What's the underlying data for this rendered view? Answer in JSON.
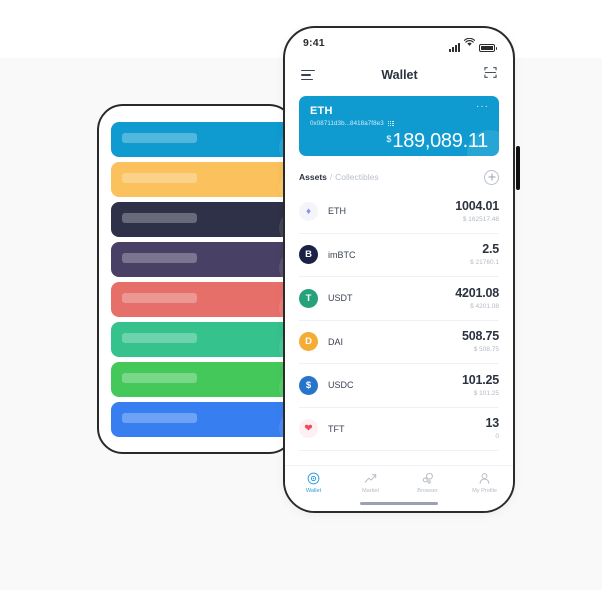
{
  "device": {
    "status_bar": {
      "time": "9:41",
      "icons": [
        "signal-icon",
        "wifi-icon",
        "battery-icon"
      ]
    }
  },
  "header": {
    "menu_icon": "hamburger-menu-icon",
    "title": "Wallet",
    "scan_icon": "scan-qr-icon"
  },
  "balance_card": {
    "wallet_name": "ETH",
    "address": "0x08711d3b...8418a7f8e3",
    "copy_icon": "copy-address-icon",
    "more_icon": "more-options-icon",
    "currency_symbol": "$",
    "amount": "189,089.11",
    "color": "#0f9bd0"
  },
  "tabs": {
    "assets_label": "Assets",
    "separator": "/",
    "collectibles_label": "Collectibles",
    "add_icon": "add-asset-icon"
  },
  "assets": [
    {
      "symbol": "ETH",
      "amount": "1004.01",
      "fiat": "$ 162517.48",
      "icon": "eth-icon",
      "icon_bg": "#f4f5f8",
      "icon_color": "#8a90f0",
      "glyph": "♦"
    },
    {
      "symbol": "imBTC",
      "amount": "2.5",
      "fiat": "$ 21760.1",
      "icon": "imbtc-icon",
      "icon_bg": "#1c2145",
      "icon_color": "#ffffff",
      "glyph": "B"
    },
    {
      "symbol": "USDT",
      "amount": "4201.08",
      "fiat": "$ 4201.08",
      "icon": "usdt-icon",
      "icon_bg": "#26a17b",
      "icon_color": "#ffffff",
      "glyph": "T"
    },
    {
      "symbol": "DAI",
      "amount": "508.75",
      "fiat": "$ 508.75",
      "icon": "dai-icon",
      "icon_bg": "#f5ac37",
      "icon_color": "#ffffff",
      "glyph": "D"
    },
    {
      "symbol": "USDC",
      "amount": "101.25",
      "fiat": "$ 101.25",
      "icon": "usdc-icon",
      "icon_bg": "#2775ca",
      "icon_color": "#ffffff",
      "glyph": "$"
    },
    {
      "symbol": "TFT",
      "amount": "13",
      "fiat": "0",
      "icon": "tft-icon",
      "icon_bg": "#fdf0f2",
      "icon_color": "#ef4b5e",
      "glyph": "❤"
    }
  ],
  "bottom_nav": [
    {
      "label": "Wallet",
      "icon": "wallet-icon",
      "active": true
    },
    {
      "label": "Market",
      "icon": "market-icon",
      "active": false
    },
    {
      "label": "Browser",
      "icon": "browser-icon",
      "active": false
    },
    {
      "label": "My Profile",
      "icon": "profile-icon",
      "active": false
    }
  ],
  "back_phone": {
    "placeholder_cards": [
      {
        "color": "#0f9bd0",
        "glyph": "♦"
      },
      {
        "color": "#fac15c",
        "glyph": "B"
      },
      {
        "color": "#2e3147",
        "glyph": "⚛"
      },
      {
        "color": "#494066",
        "glyph": "◈"
      },
      {
        "color": "#e76f6a",
        "glyph": "△"
      },
      {
        "color": "#35c28d",
        "glyph": "N"
      },
      {
        "color": "#45c85a",
        "glyph": "B"
      },
      {
        "color": "#377ef0",
        "glyph": "L"
      }
    ]
  },
  "theme": {
    "accent": "#2f9fe0",
    "page_background": "#f9f9fa",
    "frame_color": "#2a2a2a"
  }
}
